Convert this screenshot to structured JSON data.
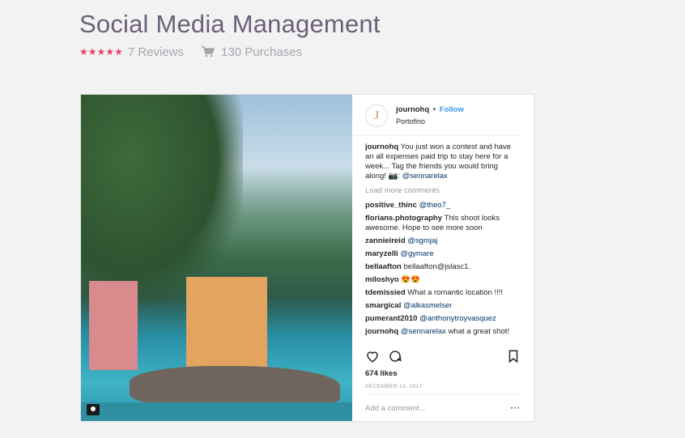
{
  "product": {
    "title": "Social Media Management",
    "rating": 4.5,
    "reviews_label": "7 Reviews",
    "purchases_label": "130 Purchases"
  },
  "post": {
    "avatar_letter": "J",
    "username": "journohq",
    "follow_label": "Follow",
    "location": "Portofino",
    "caption_user": "journohq",
    "caption_text": "You just won a contest and have an all expenses paid trip to stay here for a week... Tag the friends you would bring along! 📷: ",
    "caption_mention": "@sennarelax",
    "load_more": "Load more comments",
    "comments": [
      {
        "user": "positive_thinc",
        "text": "",
        "mention": "@theo7_"
      },
      {
        "user": "florians.photography",
        "text": "This shoot looks awesome. Hope to see more soon",
        "mention": ""
      },
      {
        "user": "zannieireid",
        "text": "",
        "mention": "@sgmjaj"
      },
      {
        "user": "maryzelli",
        "text": "",
        "mention": "@gymare"
      },
      {
        "user": "bellaafton",
        "text": "bellaafton@jslasc1.",
        "mention": ""
      },
      {
        "user": "miloshyo",
        "text": "😍😍",
        "mention": ""
      },
      {
        "user": "tdemissied",
        "text": "What a romantic location !!!!",
        "mention": ""
      },
      {
        "user": "smargical",
        "text": "",
        "mention": "@alkasmelser"
      },
      {
        "user": "pumerant2010",
        "text": "",
        "mention": "@anthonytroyvasquez"
      },
      {
        "user": "journohq",
        "text": "what a great shot!",
        "mention": "@sennarelax"
      }
    ],
    "likes": "674 likes",
    "date": "DECEMBER 13, 2017",
    "add_comment_placeholder": "Add a comment...",
    "more_label": "···"
  },
  "colors": {
    "title": "#6b6178",
    "star": "#e8416b",
    "follow": "#3897f0",
    "mention": "#003569"
  },
  "icons": [
    "star-icon",
    "cart-icon",
    "heart-icon",
    "comment-icon",
    "bookmark-icon",
    "camera-icon"
  ]
}
